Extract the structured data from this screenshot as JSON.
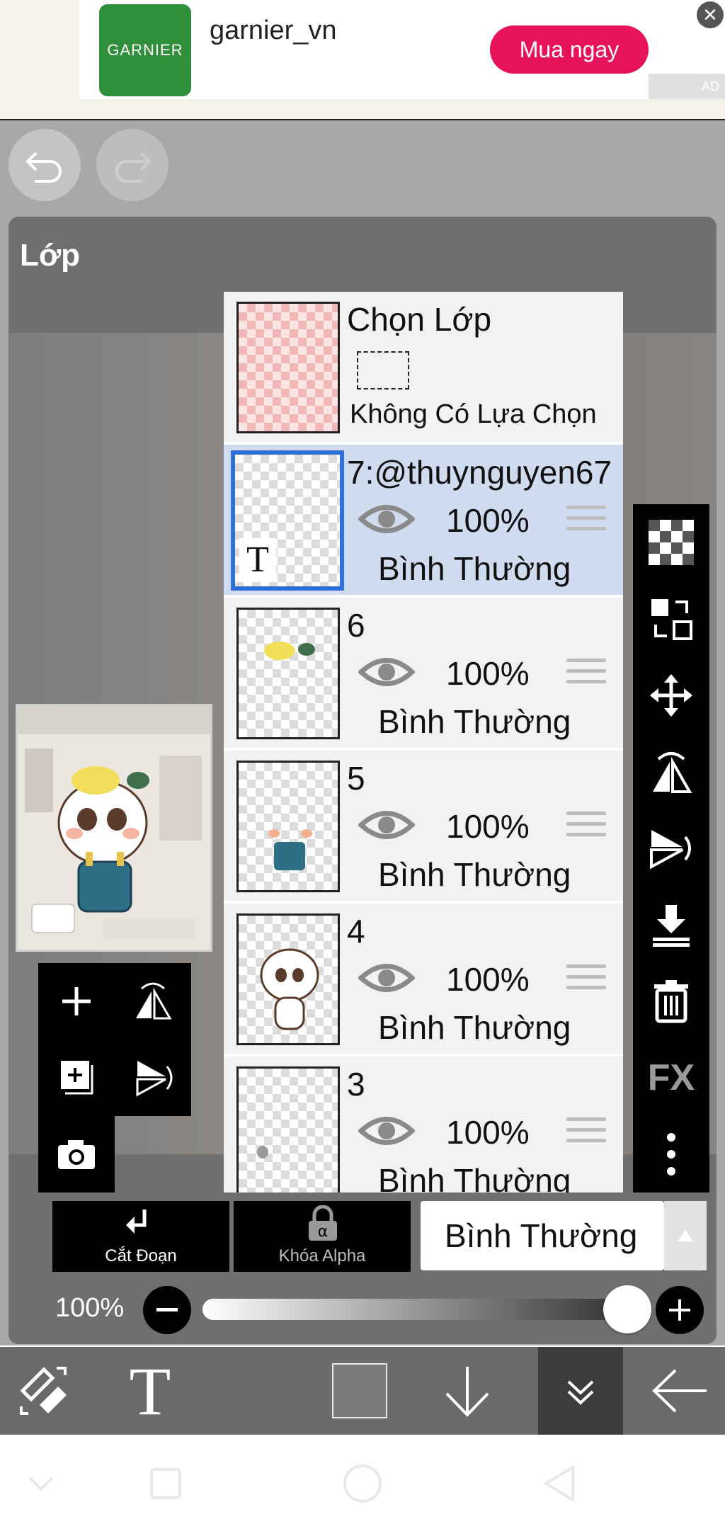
{
  "ad": {
    "logo_text": "GARNIER",
    "account": "garnier_vn",
    "cta": "Mua ngay",
    "tag": "AD",
    "close_symbol": "✕",
    "brand_color": "#2f8f3a",
    "cta_color": "#e8125c"
  },
  "panel": {
    "title": "Lớp"
  },
  "selection_row": {
    "title": "Chọn Lớp",
    "status": "Không Có Lựa Chọn"
  },
  "layers": [
    {
      "name": "7:@thuynguyen67",
      "opacity": "100%",
      "blend": "Bình Thường",
      "selected": true,
      "thumb_icon": "text-layer-icon"
    },
    {
      "name": "6",
      "opacity": "100%",
      "blend": "Bình Thường",
      "selected": false
    },
    {
      "name": "5",
      "opacity": "100%",
      "blend": "Bình Thường",
      "selected": false
    },
    {
      "name": "4",
      "opacity": "100%",
      "blend": "Bình Thường",
      "selected": false
    },
    {
      "name": "3",
      "opacity": "100%",
      "blend": "Bình Thường",
      "selected": false
    }
  ],
  "actions": {
    "clipping": "Cắt Đoạn",
    "alpha_lock": "Khóa Alpha",
    "blend_mode": "Bình Thường"
  },
  "opacity": {
    "label": "100%",
    "value": 1.0
  },
  "right_tools": [
    "checker-icon",
    "transfer-icon",
    "move-icon",
    "flip-horizontal-icon",
    "flip-vertical-icon",
    "merge-down-icon",
    "trash-icon",
    "fx-icon",
    "more-icon"
  ],
  "fx_label": "FX",
  "thumb_text_glyph": "T"
}
